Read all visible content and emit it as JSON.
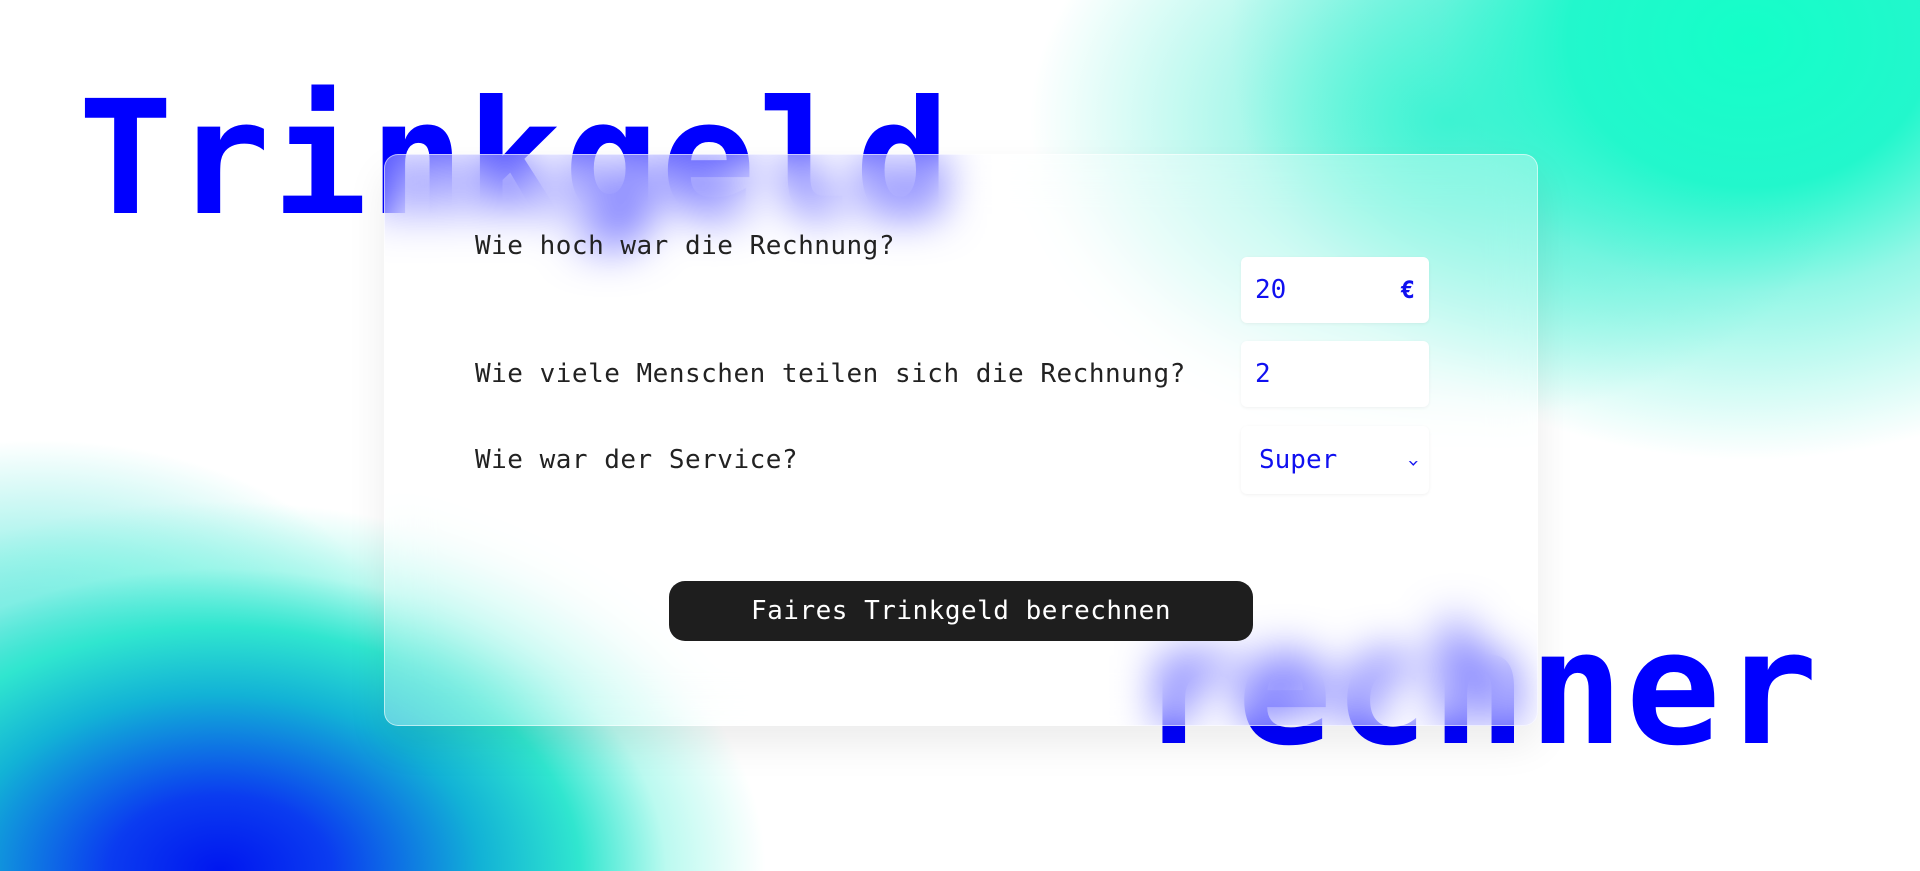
{
  "headline": {
    "line1": "Trinkgeld",
    "line2": "rechner",
    "color": "#0000ff"
  },
  "form": {
    "bill": {
      "label": "Wie hoch war die Rechnung?",
      "value": "20",
      "suffix": "€"
    },
    "people": {
      "label": "Wie viele Menschen teilen sich die Rechnung?",
      "value": "2"
    },
    "service": {
      "label": "Wie war der Service?",
      "selected": "Super",
      "icon": "chevron-down-icon"
    },
    "submit_label": "Faires Trinkgeld berechnen"
  },
  "colors": {
    "accent": "#1010f0",
    "button_bg": "#1e1e1e",
    "gradient_cyan": "#14ffc8",
    "gradient_blue": "#0016f0"
  }
}
